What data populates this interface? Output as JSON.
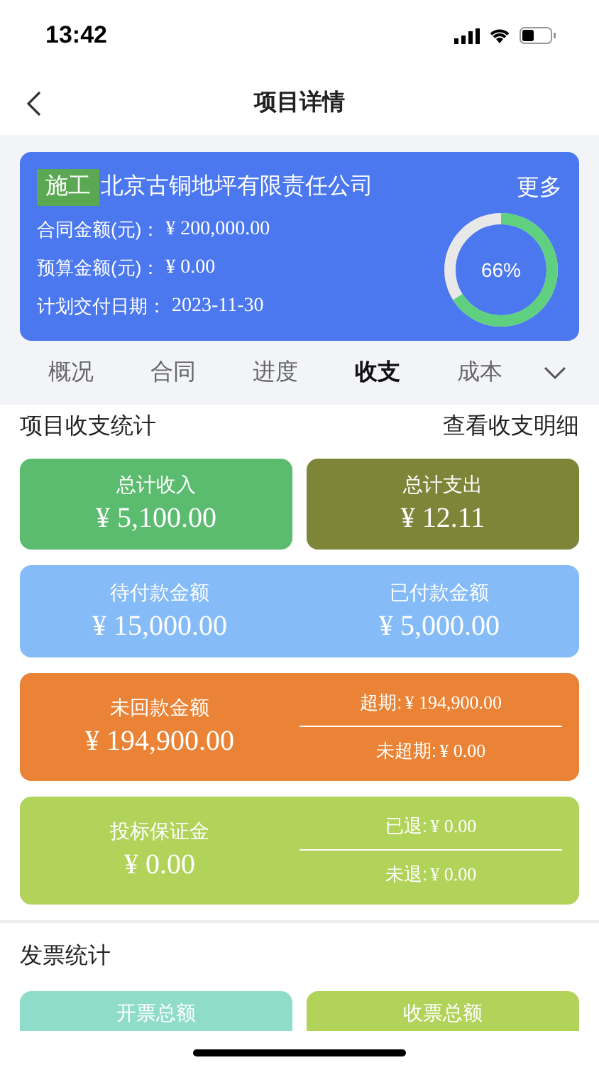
{
  "status_bar": {
    "time": "13:42"
  },
  "header": {
    "title": "项目详情"
  },
  "project": {
    "tag": "施工",
    "name": "北京古铜地坪有限责任公司",
    "more": "更多",
    "rows": [
      {
        "label": "合同金额(元)：",
        "value": "¥ 200,000.00"
      },
      {
        "label": "预算金额(元)：",
        "value": "¥ 0.00"
      },
      {
        "label": "计划交付日期：",
        "value": "2023-11-30"
      }
    ],
    "progress": {
      "level": 0.66,
      "label": "66%"
    }
  },
  "tabs": [
    {
      "label": "概况",
      "selected": false
    },
    {
      "label": "合同",
      "selected": false
    },
    {
      "label": "进度",
      "selected": false
    },
    {
      "label": "收支",
      "selected": true
    },
    {
      "label": "成本",
      "selected": false
    }
  ],
  "income_section": {
    "title": "项目收支统计",
    "link": "查看收支明细",
    "cards": [
      {
        "kind": "half",
        "color": "#5bbb6f",
        "label": "总计收入",
        "value": "¥ 5,100.00"
      },
      {
        "kind": "half",
        "color": "#7e8538",
        "label": "总计支出",
        "value": "¥ 12.11"
      },
      {
        "kind": "pair",
        "color": "#85bbf7",
        "items": [
          {
            "label": "待付款金额",
            "value": "¥ 15,000.00"
          },
          {
            "label": "已付款金额",
            "value": "¥ 5,000.00"
          }
        ]
      },
      {
        "kind": "split",
        "color": "#ea8335",
        "label": "未回款金额",
        "value": "¥ 194,900.00",
        "lines": [
          {
            "label": "超期:",
            "value": "¥ 194,900.00"
          },
          {
            "label": "未超期:",
            "value": "¥ 0.00"
          }
        ]
      },
      {
        "kind": "split",
        "color": "#b1d35a",
        "label": "投标保证金",
        "value": "¥ 0.00",
        "lines": [
          {
            "label": "已退:",
            "value": "¥ 0.00"
          },
          {
            "label": "未退:",
            "value": "¥ 0.00"
          }
        ]
      }
    ]
  },
  "invoice_section": {
    "title": "发票统计",
    "cards": [
      {
        "label": "开票总额",
        "color": "#90dccb"
      },
      {
        "label": "收票总额",
        "color": "#b1d35a"
      }
    ]
  }
}
